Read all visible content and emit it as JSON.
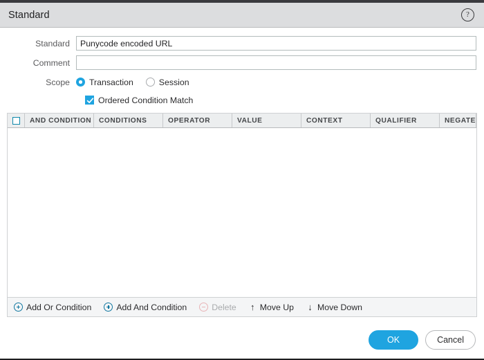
{
  "window": {
    "title": "Standard",
    "help_icon": "help-circle-icon",
    "help_glyph": "?"
  },
  "form": {
    "standard": {
      "label": "Standard",
      "value": "Punycode encoded URL",
      "placeholder": ""
    },
    "comment": {
      "label": "Comment",
      "value": "",
      "placeholder": ""
    },
    "scope": {
      "label": "Scope",
      "options": [
        {
          "label": "Transaction",
          "selected": true
        },
        {
          "label": "Session",
          "selected": false
        }
      ]
    },
    "ordered_condition_match": {
      "label": "Ordered Condition Match",
      "checked": true
    }
  },
  "grid": {
    "select_all_checked": false,
    "columns": [
      {
        "key": "select",
        "label": ""
      },
      {
        "key": "and_condition",
        "label": "AND CONDITION"
      },
      {
        "key": "conditions",
        "label": "CONDITIONS"
      },
      {
        "key": "operator",
        "label": "OPERATOR"
      },
      {
        "key": "value",
        "label": "VALUE"
      },
      {
        "key": "context",
        "label": "CONTEXT"
      },
      {
        "key": "qualifier",
        "label": "QUALIFIER"
      },
      {
        "key": "negate",
        "label": "NEGATE"
      }
    ],
    "rows": []
  },
  "toolbar": {
    "add_or_condition": {
      "label": "Add Or Condition",
      "icon": "plus-circle-icon",
      "disabled": false
    },
    "add_and_condition": {
      "label": "Add And Condition",
      "icon": "plus-circle-icon",
      "disabled": false
    },
    "delete": {
      "label": "Delete",
      "icon": "minus-circle-icon",
      "disabled": true
    },
    "move_up": {
      "label": "Move Up",
      "icon": "arrow-up-icon",
      "glyph": "↑",
      "disabled": false
    },
    "move_down": {
      "label": "Move Down",
      "icon": "arrow-down-icon",
      "glyph": "↓",
      "disabled": false
    }
  },
  "footer": {
    "ok_label": "OK",
    "cancel_label": "Cancel"
  },
  "colors": {
    "accent_blue": "#1fa4e0",
    "icon_teal": "#1077a0",
    "titlebar": "#dcdddf",
    "grid_header": "#eceeef",
    "toolbar_bg": "#f4f5f6",
    "disabled_text": "#a9abad"
  }
}
